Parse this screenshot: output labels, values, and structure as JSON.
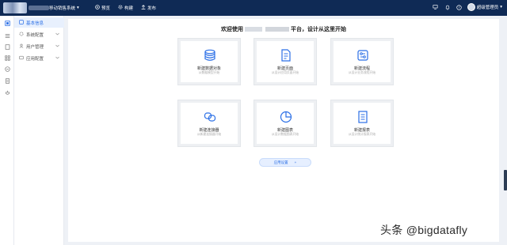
{
  "header": {
    "app_title": "移动销售系统",
    "nav": [
      {
        "label": "预览",
        "icon": "eye-icon"
      },
      {
        "label": "构建",
        "icon": "gear-icon"
      },
      {
        "label": "发布",
        "icon": "publish-icon"
      }
    ],
    "user_name": "超级管理员"
  },
  "sidebar": {
    "items": [
      {
        "label": "基本信息",
        "active": true
      },
      {
        "label": "系统配置",
        "active": false
      },
      {
        "label": "用户管理",
        "active": false
      },
      {
        "label": "应用配置",
        "active": false
      }
    ]
  },
  "main": {
    "welcome_prefix": "欢迎使用",
    "welcome_mid": "平台，设计从这里开始",
    "cards": [
      {
        "title": "新建数据对象",
        "sub": "从数据模型开始",
        "icon": "database-icon"
      },
      {
        "title": "新建页面",
        "sub": "从设计应用页面开始",
        "icon": "page-icon"
      },
      {
        "title": "新建流程",
        "sub": "从设计业务流程开始",
        "icon": "flow-icon"
      },
      {
        "title": "新建连接器",
        "sub": "从新建连接器开始",
        "icon": "connector-icon"
      },
      {
        "title": "新建图表",
        "sub": "从设计数据图表开始",
        "icon": "chart-icon"
      },
      {
        "title": "新建报表",
        "sub": "从设计统计报表开始",
        "icon": "report-icon"
      }
    ],
    "settings_label": "应用设置",
    "settings_plus": "+"
  },
  "watermark": "头条 @bigdatafly",
  "colors": {
    "topbar": "#0f2a55",
    "accent": "#2b6fe6",
    "card_border": "#eef0f3"
  }
}
